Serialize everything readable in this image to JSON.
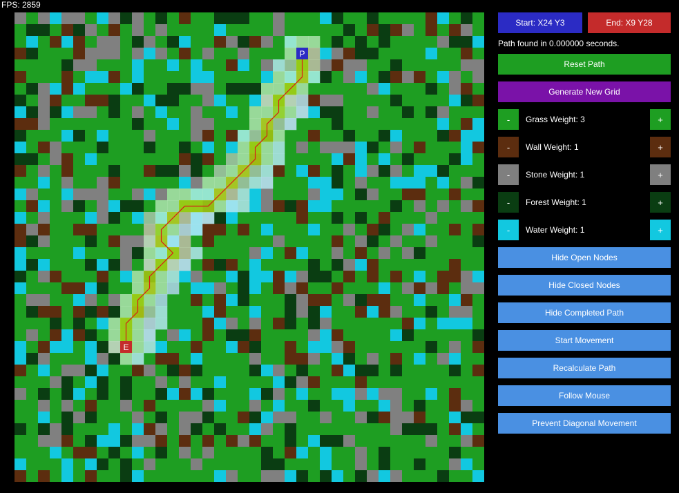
{
  "fps_text": "FPS: 2859",
  "start_label": "Start: X24 Y3",
  "end_label": "End: X9 Y28",
  "status_text": "Path found in 0.000000 seconds.",
  "buttons": {
    "reset_path": "Reset Path",
    "generate_grid": "Generate New Grid",
    "hide_open": "Hide Open Nodes",
    "hide_closed": "Hide Closed Nodes",
    "hide_path": "Hide Completed Path",
    "start_movement": "Start Movement",
    "recalculate": "Recalculate Path",
    "follow_mouse": "Follow Mouse",
    "prevent_diagonal": "Prevent Diagonal Movement"
  },
  "weights": [
    {
      "id": "grass",
      "label": "Grass Weight: 3",
      "minus": "-",
      "plus": "+",
      "color": "#1e9e22"
    },
    {
      "id": "wall",
      "label": "Wall Weight: 1",
      "minus": "-",
      "plus": "+",
      "color": "#5c2d0f"
    },
    {
      "id": "stone",
      "label": "Stone Weight: 1",
      "minus": "-",
      "plus": "+",
      "color": "#7f7f7f"
    },
    {
      "id": "forest",
      "label": "Forest Weight: 1",
      "minus": "-",
      "plus": "+",
      "color": "#0a3d12"
    },
    {
      "id": "water",
      "label": "Water Weight: 1",
      "minus": "-",
      "plus": "+",
      "color": "#12c8e0"
    }
  ],
  "colors": {
    "start_btn": "#2b2bc4",
    "end_btn": "#c42b2b",
    "green_btn": "#1e9e22",
    "purple_btn": "#7a12a8",
    "blue_btn": "#4a90e2",
    "grass": "#1e9e22",
    "wall": "#5c2d0f",
    "stone": "#808080",
    "forest": "#0a3d12",
    "water": "#12c8e0",
    "path_line": "#d81818",
    "start_marker": "#2b2bc4",
    "end_marker": "#c42b2b"
  },
  "grid": {
    "cols": 40,
    "rows": 40,
    "start": {
      "x": 24,
      "y": 3,
      "label": "P"
    },
    "end": {
      "x": 9,
      "y": 28,
      "label": "E"
    },
    "path": [
      [
        24,
        3
      ],
      [
        24,
        4
      ],
      [
        24,
        5
      ],
      [
        23,
        6
      ],
      [
        22,
        7
      ],
      [
        22,
        8
      ],
      [
        21,
        9
      ],
      [
        21,
        10
      ],
      [
        20,
        11
      ],
      [
        20,
        12
      ],
      [
        19,
        13
      ],
      [
        18,
        14
      ],
      [
        17,
        15
      ],
      [
        16,
        16
      ],
      [
        15,
        16
      ],
      [
        14,
        16
      ],
      [
        13,
        17
      ],
      [
        12,
        18
      ],
      [
        12,
        19
      ],
      [
        13,
        20
      ],
      [
        12,
        21
      ],
      [
        11,
        22
      ],
      [
        11,
        23
      ],
      [
        10,
        24
      ],
      [
        10,
        25
      ],
      [
        9,
        26
      ],
      [
        9,
        27
      ],
      [
        9,
        28
      ]
    ],
    "open_nodes": [
      [
        23,
        2
      ],
      [
        24,
        2
      ],
      [
        25,
        2
      ],
      [
        23,
        3
      ],
      [
        25,
        3
      ],
      [
        23,
        4
      ],
      [
        25,
        4
      ],
      [
        22,
        5
      ],
      [
        23,
        5
      ],
      [
        25,
        5
      ],
      [
        21,
        6
      ],
      [
        22,
        6
      ],
      [
        24,
        6
      ],
      [
        21,
        7
      ],
      [
        23,
        7
      ],
      [
        20,
        8
      ],
      [
        21,
        8
      ],
      [
        23,
        8
      ],
      [
        20,
        9
      ],
      [
        22,
        9
      ],
      [
        19,
        10
      ],
      [
        20,
        10
      ],
      [
        22,
        10
      ],
      [
        19,
        11
      ],
      [
        21,
        11
      ],
      [
        18,
        12
      ],
      [
        19,
        12
      ],
      [
        21,
        12
      ],
      [
        17,
        13
      ],
      [
        18,
        13
      ],
      [
        20,
        13
      ],
      [
        16,
        14
      ],
      [
        17,
        14
      ],
      [
        19,
        14
      ],
      [
        15,
        15
      ],
      [
        16,
        15
      ],
      [
        18,
        15
      ],
      [
        14,
        15
      ],
      [
        13,
        15
      ],
      [
        12,
        16
      ],
      [
        13,
        16
      ],
      [
        17,
        16
      ],
      [
        11,
        17
      ],
      [
        12,
        17
      ],
      [
        14,
        17
      ],
      [
        11,
        18
      ],
      [
        13,
        18
      ],
      [
        11,
        19
      ],
      [
        14,
        19
      ],
      [
        12,
        20
      ],
      [
        14,
        20
      ],
      [
        11,
        20
      ],
      [
        11,
        21
      ],
      [
        13,
        21
      ],
      [
        10,
        22
      ],
      [
        12,
        22
      ],
      [
        10,
        23
      ],
      [
        12,
        23
      ],
      [
        9,
        24
      ],
      [
        11,
        24
      ],
      [
        9,
        25
      ],
      [
        11,
        25
      ],
      [
        8,
        26
      ],
      [
        10,
        26
      ],
      [
        8,
        27
      ],
      [
        10,
        27
      ],
      [
        8,
        28
      ],
      [
        10,
        28
      ],
      [
        9,
        29
      ]
    ],
    "closed_nodes": [
      [
        22,
        4
      ],
      [
        24,
        7
      ],
      [
        22,
        11
      ],
      [
        21,
        13
      ],
      [
        20,
        14
      ],
      [
        19,
        15
      ],
      [
        18,
        16
      ],
      [
        19,
        16
      ],
      [
        15,
        17
      ],
      [
        16,
        17
      ],
      [
        14,
        18
      ],
      [
        15,
        18
      ],
      [
        13,
        19
      ],
      [
        15,
        20
      ],
      [
        14,
        21
      ],
      [
        13,
        22
      ],
      [
        13,
        23
      ],
      [
        12,
        24
      ],
      [
        12,
        25
      ],
      [
        11,
        26
      ],
      [
        11,
        27
      ],
      [
        12,
        26
      ],
      [
        23,
        9
      ],
      [
        24,
        8
      ],
      [
        21,
        14
      ],
      [
        22,
        12
      ],
      [
        10,
        29
      ],
      [
        11,
        28
      ]
    ]
  }
}
